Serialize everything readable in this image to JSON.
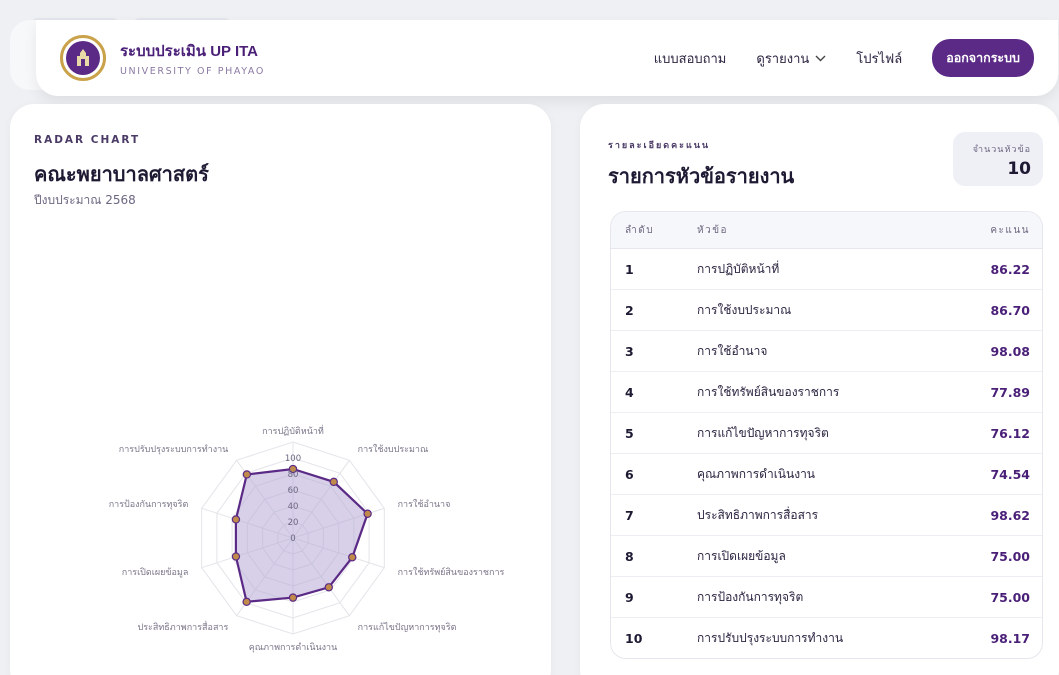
{
  "nav": {
    "brand_title": "ระบบประเมิน UP ITA",
    "brand_subtitle": "UNIVERSITY OF PHAYAO",
    "links": [
      {
        "label": "แบบสอบถาม"
      },
      {
        "label": "ดูรายงาน"
      },
      {
        "label": "โปรไฟล์"
      }
    ],
    "logout_label": "ออกจากระบบ"
  },
  "radar_card": {
    "kicker": "RADAR CHART",
    "title": "คณะพยาบาลศาสตร์",
    "subtitle": "ปีงบประมาณ 2568"
  },
  "chart_data": {
    "type": "radar",
    "categories": [
      "การปฏิบัติหน้าที่",
      "การใช้งบประมาณ",
      "การใช้อำนาจ",
      "การใช้ทรัพย์สินของราชการ",
      "การแก้ไขปัญหาการทุจริต",
      "คุณภาพการดำเนินงาน",
      "ประสิทธิภาพการสื่อสาร",
      "การเปิดเผยข้อมูล",
      "การป้องกันการทุจริต",
      "การปรับปรุงระบบการทำงาน"
    ],
    "values": [
      86.22,
      86.7,
      98.08,
      77.89,
      76.12,
      74.54,
      98.62,
      75.0,
      75.0,
      98.17
    ],
    "ticks": [
      "0",
      "20",
      "40",
      "60",
      "80",
      "100"
    ],
    "rlim": [
      0,
      100
    ],
    "colors": {
      "line": "#5b2a86",
      "fill": "#b7a9d6",
      "point": "#c08a4a"
    }
  },
  "list_card": {
    "kicker": "รายละเอียดคะแนน",
    "title": "รายการหัวข้อรายงาน",
    "count_label": "จำนวนหัวข้อ",
    "count_value": "10",
    "columns": {
      "no": "ลำดับ",
      "topic": "หัวข้อ",
      "score": "คะแนน"
    },
    "rows": [
      {
        "no": "1",
        "topic": "การปฏิบัติหน้าที่",
        "score": "86.22"
      },
      {
        "no": "2",
        "topic": "การใช้งบประมาณ",
        "score": "86.70"
      },
      {
        "no": "3",
        "topic": "การใช้อำนาจ",
        "score": "98.08"
      },
      {
        "no": "4",
        "topic": "การใช้ทรัพย์สินของราชการ",
        "score": "77.89"
      },
      {
        "no": "5",
        "topic": "การแก้ไขปัญหาการทุจริต",
        "score": "76.12"
      },
      {
        "no": "6",
        "topic": "คุณภาพการดำเนินงาน",
        "score": "74.54"
      },
      {
        "no": "7",
        "topic": "ประสิทธิภาพการสื่อสาร",
        "score": "98.62"
      },
      {
        "no": "8",
        "topic": "การเปิดเผยข้อมูล",
        "score": "75.00"
      },
      {
        "no": "9",
        "topic": "การป้องกันการทุจริต",
        "score": "75.00"
      },
      {
        "no": "10",
        "topic": "การปรับปรุงระบบการทำงาน",
        "score": "98.17"
      }
    ]
  }
}
